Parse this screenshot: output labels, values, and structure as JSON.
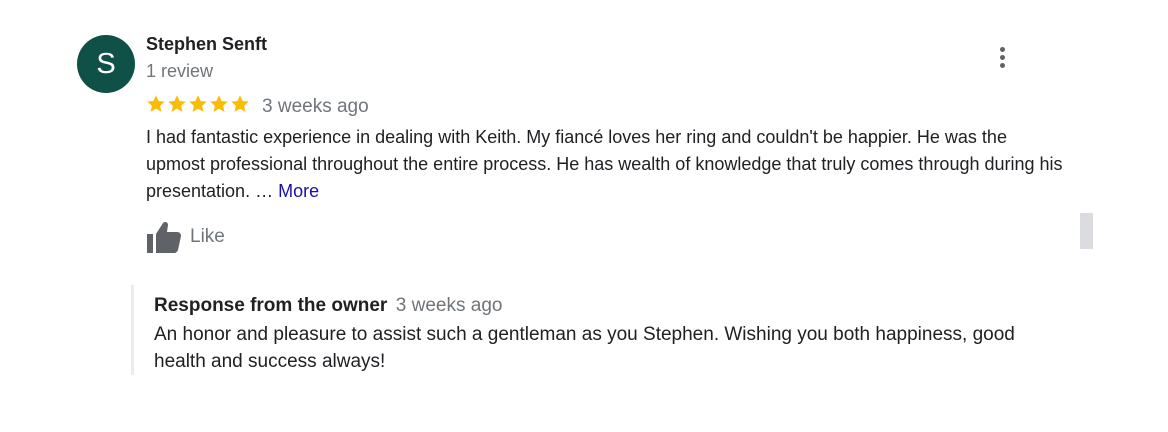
{
  "reviewer": {
    "initial": "S",
    "avatar_color": "#0f5146",
    "name": "Stephen Senft",
    "review_count": "1 review"
  },
  "menu": {
    "icon": "more-vert-icon"
  },
  "rating": {
    "stars": 5,
    "max": 5,
    "star_color": "#fbbc04",
    "icon": "star-icon"
  },
  "review": {
    "time": "3 weeks ago",
    "text": "I had fantastic experience in dealing with Keith. My fiancé loves her ring and couldn't be happier. He was the upmost professional throughout the entire process. He has wealth of knowledge that truly comes through during his presentation. … ",
    "more_label": "More"
  },
  "like": {
    "icon": "thumbs-up-icon",
    "label": "Like"
  },
  "owner_response": {
    "title": "Response from the owner",
    "time": "3 weeks ago",
    "text": "An honor and pleasure to assist such a gentleman as you Stephen. Wishing you both happiness, good health and success always!"
  }
}
